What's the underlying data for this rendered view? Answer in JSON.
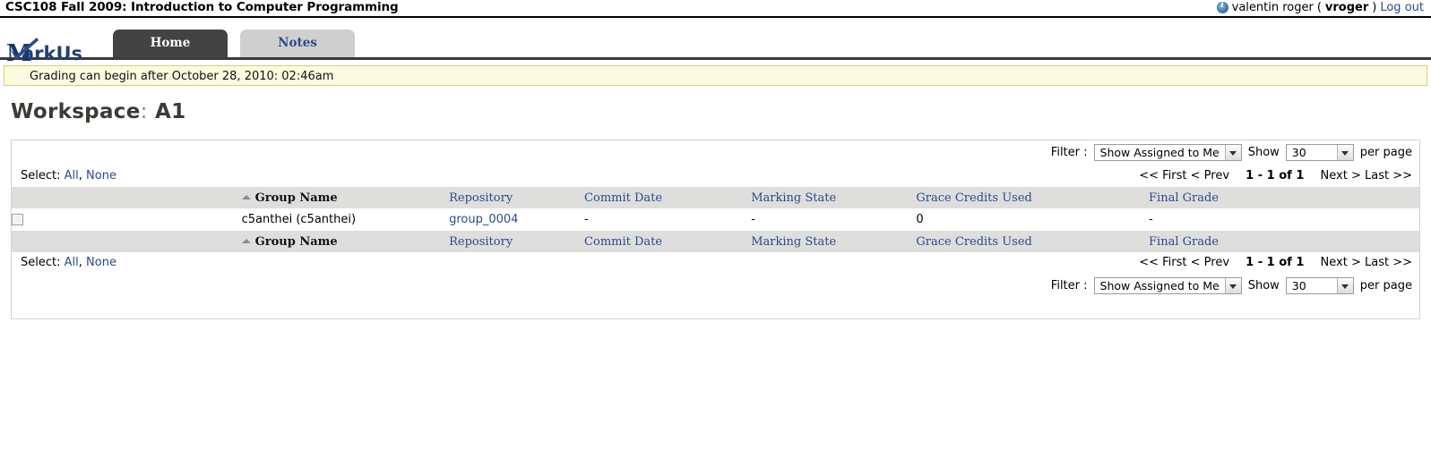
{
  "header": {
    "course_title": "CSC108 Fall 2009: Introduction to Computer Programming",
    "info_icon": "info-circle-icon",
    "user_display_name": "valentin roger",
    "paren_open": "(",
    "user_login": "vroger",
    "paren_close": ")",
    "logout_label": "Log out"
  },
  "branding": {
    "logo_text": "arkUs",
    "logo_initial": "M",
    "logo_icon": "checkmark-icon"
  },
  "tabs": [
    {
      "label": "Home",
      "active": true
    },
    {
      "label": "Notes",
      "active": false
    }
  ],
  "notice": {
    "text": "Grading can begin after October 28, 2010: 02:46am"
  },
  "page": {
    "title_label": "Workspace",
    "title_separator": ":",
    "title_value": "A1"
  },
  "controls": {
    "filter_label": "Filter :",
    "filter_value": "Show Assigned to Me",
    "show_label": "Show",
    "per_page_value": "30",
    "per_page_label": "per page",
    "dropdown_icon": "chevron-down-icon"
  },
  "selection": {
    "select_label": "Select:",
    "all_label": "All",
    "comma": ",",
    "none_label": "None"
  },
  "pagination": {
    "first_label": "<< First",
    "prev_label": "< Prev",
    "range_label": "1 - 1 of 1",
    "next_label": "Next >",
    "last_label": "Last >>"
  },
  "table": {
    "sort_icon": "sort-ascending-icon",
    "columns": [
      {
        "key": "checkbox",
        "label": ""
      },
      {
        "key": "group_name",
        "label": "Group Name",
        "sorted": true
      },
      {
        "key": "repository",
        "label": "Repository"
      },
      {
        "key": "commit_date",
        "label": "Commit Date"
      },
      {
        "key": "marking_state",
        "label": "Marking State"
      },
      {
        "key": "grace_credits_used",
        "label": "Grace Credits Used"
      },
      {
        "key": "final_grade",
        "label": "Final Grade"
      }
    ],
    "rows": [
      {
        "checked": false,
        "group_name": "c5anthei (c5anthei)",
        "repository": "group_0004",
        "commit_date": "-",
        "marking_state": "-",
        "grace_credits_used": "0",
        "final_grade": "-"
      }
    ]
  }
}
